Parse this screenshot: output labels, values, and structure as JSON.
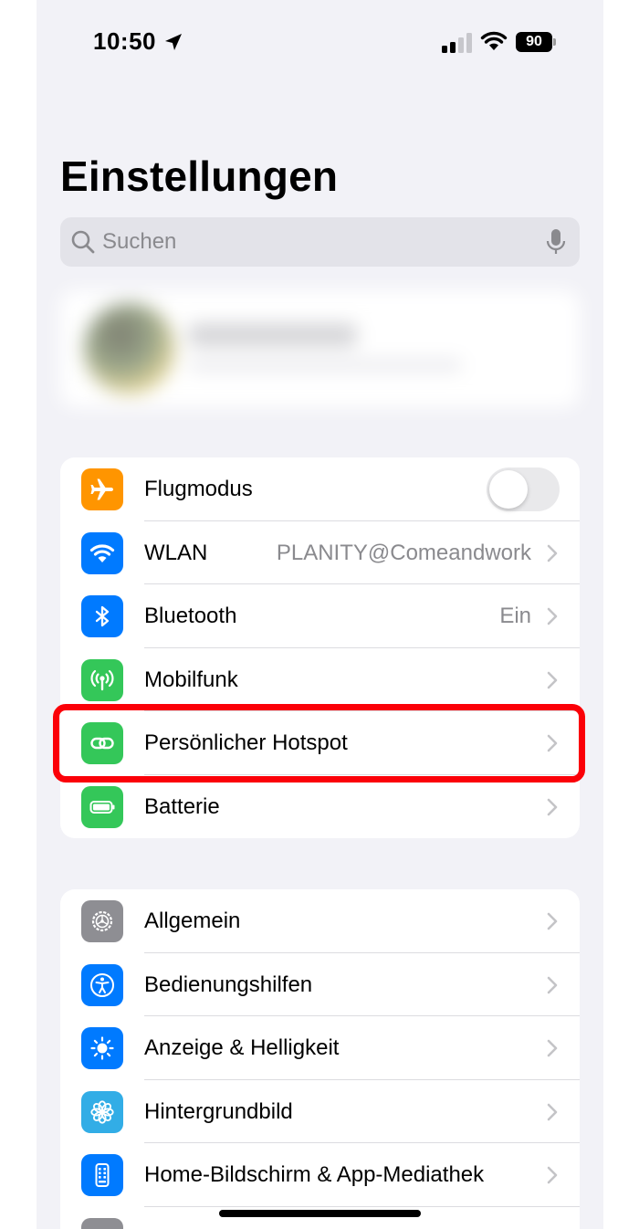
{
  "status_bar": {
    "time": "10:50",
    "battery": "90"
  },
  "page_title": "Einstellungen",
  "search": {
    "placeholder": "Suchen"
  },
  "group1": [
    {
      "id": "flugmodus",
      "label": "Flugmodus",
      "icon": "airplane-icon",
      "color": "#ff9500",
      "toggle": false
    },
    {
      "id": "wlan",
      "label": "WLAN",
      "value": "PLANITY@Comeandwork",
      "icon": "wifi-icon",
      "color": "#007aff"
    },
    {
      "id": "bluetooth",
      "label": "Bluetooth",
      "value": "Ein",
      "icon": "bluetooth-icon",
      "color": "#007aff"
    },
    {
      "id": "mobilfunk",
      "label": "Mobilfunk",
      "icon": "antenna-icon",
      "color": "#34c759"
    },
    {
      "id": "hotspot",
      "label": "Persönlicher Hotspot",
      "icon": "hotspot-link-icon",
      "color": "#34c759",
      "highlighted": true
    },
    {
      "id": "batterie",
      "label": "Batterie",
      "icon": "battery-icon",
      "color": "#34c759"
    }
  ],
  "group2": [
    {
      "id": "allgemein",
      "label": "Allgemein",
      "icon": "gear-icon",
      "color": "#8e8e93"
    },
    {
      "id": "bedienungshilfen",
      "label": "Bedienungshilfen",
      "icon": "accessibility-icon",
      "color": "#007aff"
    },
    {
      "id": "anzeige",
      "label": "Anzeige & Helligkeit",
      "icon": "sun-icon",
      "color": "#007aff"
    },
    {
      "id": "hintergrundbild",
      "label": "Hintergrundbild",
      "icon": "flower-icon",
      "color": "#32ade6"
    },
    {
      "id": "homescreen",
      "label": "Home-Bildschirm & App-Mediathek",
      "icon": "home-screen-icon",
      "color": "#007aff"
    }
  ],
  "highlight_color": "#fb0008"
}
